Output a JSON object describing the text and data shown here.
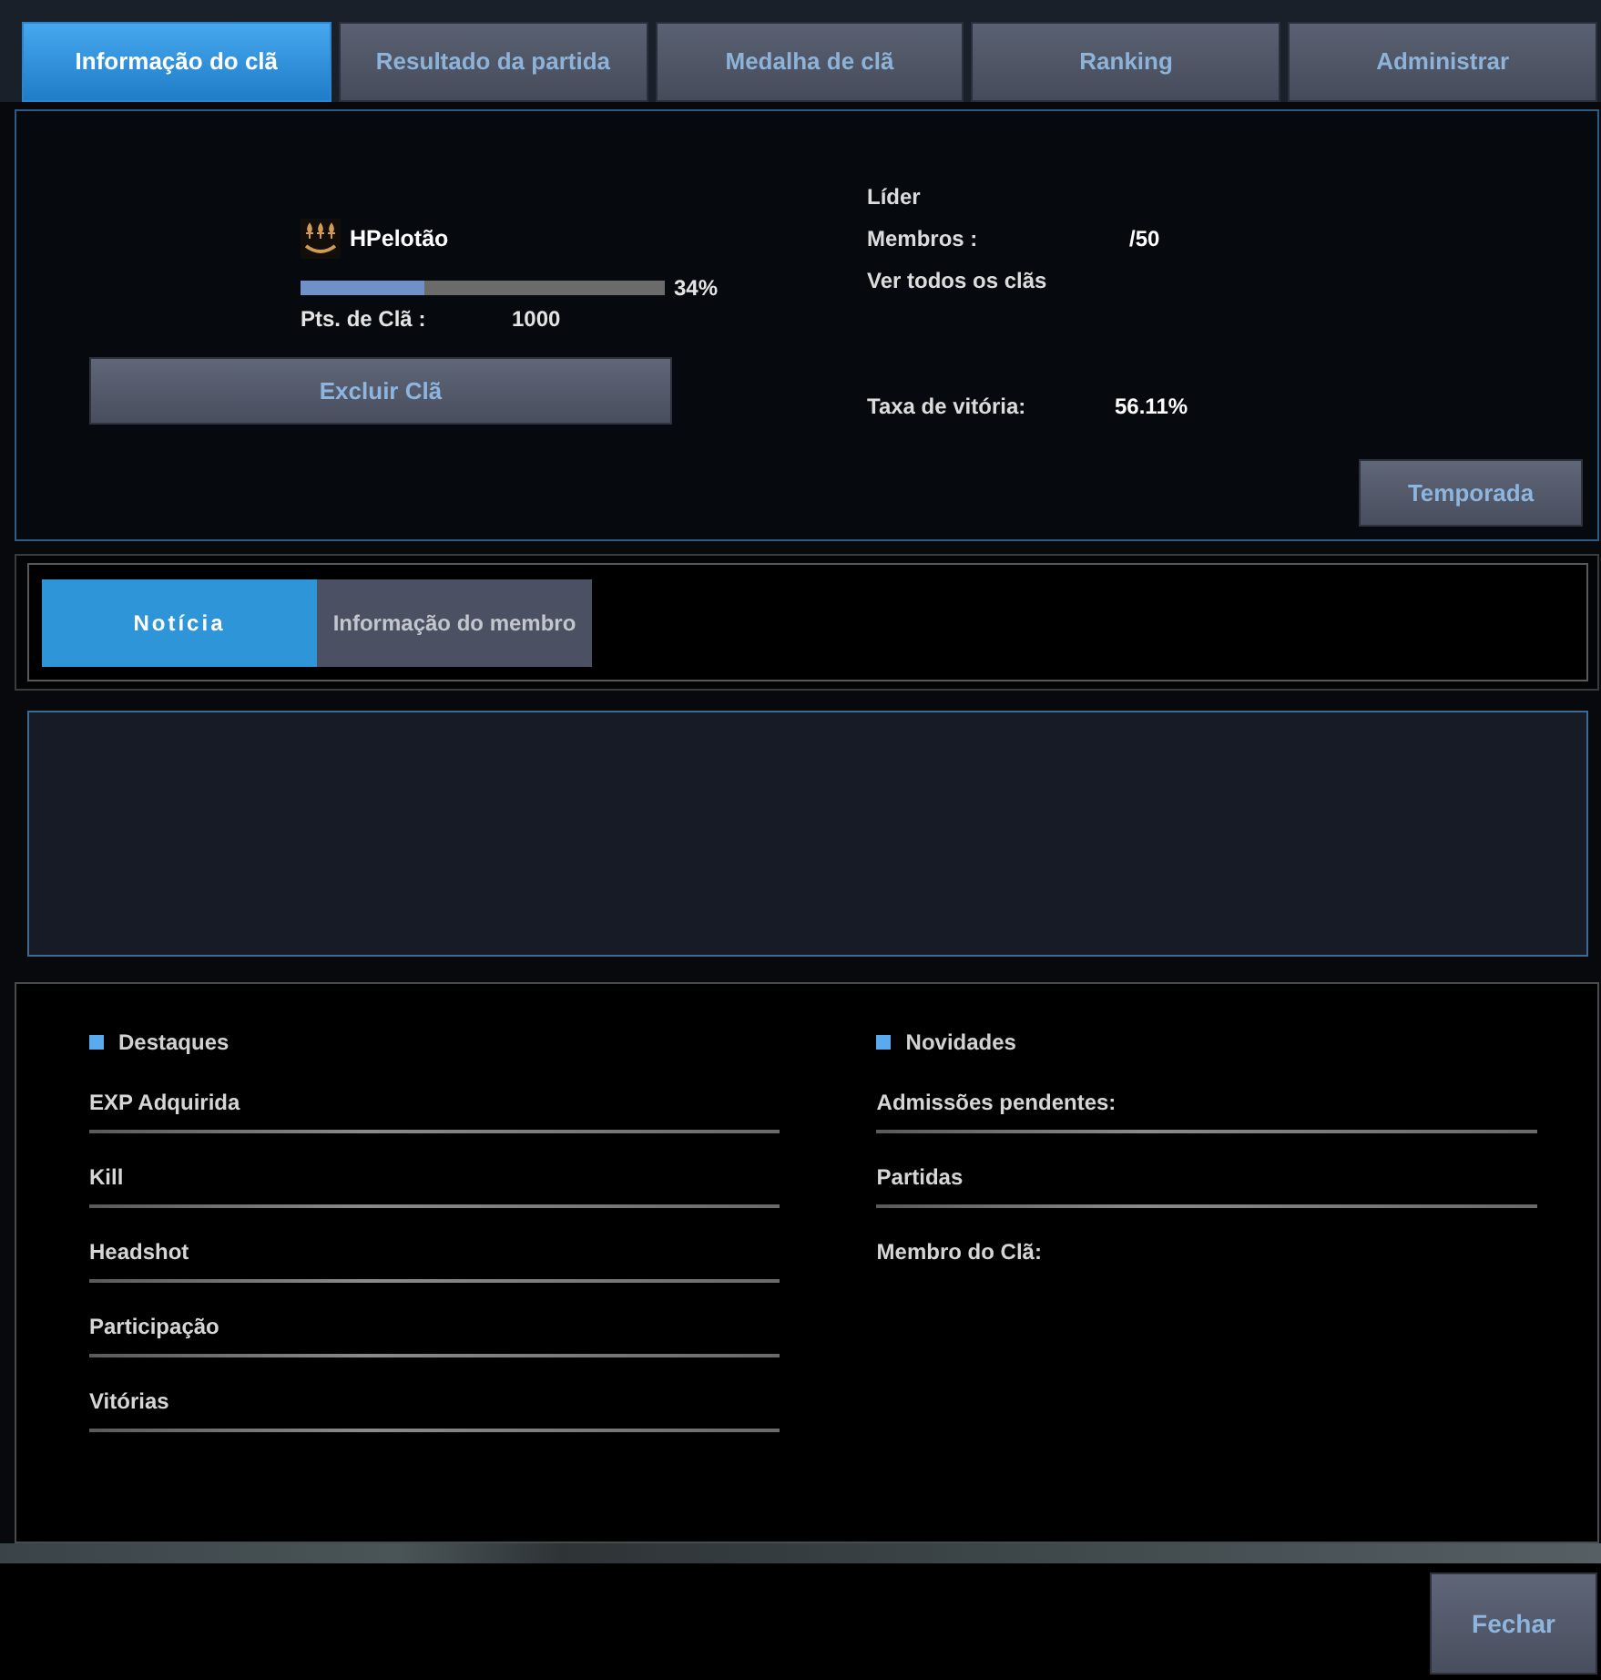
{
  "tabs": [
    {
      "label": "Informação do clã",
      "selected": true
    },
    {
      "label": "Resultado da partida",
      "selected": false
    },
    {
      "label": "Medalha de clã",
      "selected": false
    },
    {
      "label": "Ranking",
      "selected": false
    },
    {
      "label": "Administrar",
      "selected": false
    }
  ],
  "clan": {
    "name": "HPelotão",
    "progress": {
      "level": 0.34,
      "reading": "34%"
    },
    "points_label": "Pts. de Clã :",
    "points": "1000",
    "delete_button": "Excluir Clã"
  },
  "info": [
    {
      "label": "Líder"
    },
    {
      "label": "Membros :",
      "value": "/50"
    },
    {
      "label": "Ver todos os clãs"
    }
  ],
  "win_rate": {
    "label": "Taxa de vitória:",
    "value": "56.11%"
  },
  "season_button": "Temporada",
  "sub_tabs": [
    {
      "label": "Notícia",
      "selected": true
    },
    {
      "label": "Informação do membro",
      "selected": false
    }
  ],
  "highlights": {
    "title": "Destaques",
    "rows": [
      "EXP Adquirida",
      "Kill",
      "Headshot",
      "Participação",
      "Vitórias"
    ]
  },
  "news": {
    "title": "Novidades",
    "rows": [
      {
        "label": "Admissões pendentes:",
        "kind": "lined"
      },
      {
        "label": "Partidas",
        "kind": "lined"
      },
      {
        "label": "Membro do Clã:",
        "kind": "plain"
      }
    ]
  },
  "close_button": "Fechar"
}
